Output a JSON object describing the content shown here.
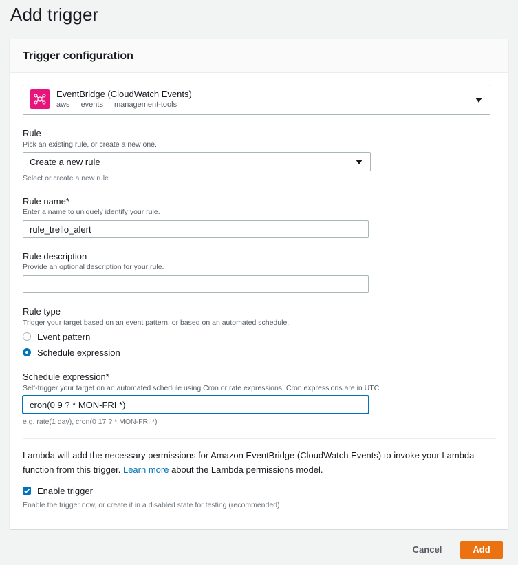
{
  "page": {
    "title": "Add trigger"
  },
  "panel": {
    "title": "Trigger configuration"
  },
  "source": {
    "name": "EventBridge (CloudWatch Events)",
    "tags": [
      "aws",
      "events",
      "management-tools"
    ],
    "icon": "eventbridge-icon",
    "icon_color": "#e7157b"
  },
  "rule": {
    "label": "Rule",
    "description": "Pick an existing rule, or create a new one.",
    "value": "Create a new rule",
    "hint": "Select or create a new rule"
  },
  "rule_name": {
    "label": "Rule name*",
    "description": "Enter a name to uniquely identify your rule.",
    "value": "rule_trello_alert"
  },
  "rule_description": {
    "label": "Rule description",
    "description": "Provide an optional description for your rule.",
    "value": ""
  },
  "rule_type": {
    "label": "Rule type",
    "description": "Trigger your target based on an event pattern, or based on an automated schedule.",
    "options": [
      {
        "label": "Event pattern",
        "selected": false
      },
      {
        "label": "Schedule expression",
        "selected": true
      }
    ]
  },
  "schedule": {
    "label": "Schedule expression*",
    "description": "Self-trigger your target on an automated schedule using Cron or rate expressions. Cron expressions are in UTC.",
    "value": "cron(0 9 ? * MON-FRI *)",
    "hint": "e.g. rate(1 day), cron(0 17 ? * MON-FRI *)"
  },
  "permissions_note": {
    "text_before": "Lambda will add the necessary permissions for Amazon EventBridge (CloudWatch Events) to invoke your Lambda function from this trigger.",
    "link": "Learn more",
    "text_after": "about the Lambda permissions model."
  },
  "enable_trigger": {
    "label": "Enable trigger",
    "checked": true,
    "description": "Enable the trigger now, or create it in a disabled state for testing (recommended)."
  },
  "footer": {
    "cancel_label": "Cancel",
    "add_label": "Add"
  },
  "colors": {
    "accent": "#0073bb",
    "primary_button": "#ec7211"
  }
}
